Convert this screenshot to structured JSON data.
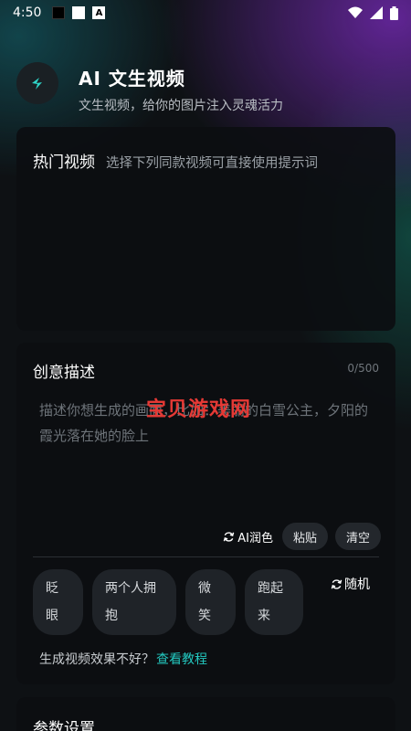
{
  "status_bar": {
    "time": "4:50"
  },
  "header": {
    "title": "AI 文生视频",
    "subtitle": "文生视频，给你的图片注入灵魂活力"
  },
  "hot_videos": {
    "title": "热门视频",
    "hint": "选择下列同款视频可直接使用提示词"
  },
  "creative": {
    "title": "创意描述",
    "counter": "0/500",
    "placeholder": "描述你想生成的画面，比如：美丽的白雪公主，夕阳的霞光落在她的脸上",
    "watermark": "宝贝游戏网",
    "ai_polish_label": "AI润色",
    "paste_label": "粘贴",
    "clear_label": "清空",
    "chips": [
      "眨眼",
      "两个人拥抱",
      "微笑",
      "跑起来"
    ],
    "random_label": "随机",
    "tutorial_text": "生成视频效果不好？",
    "tutorial_link": "查看教程"
  },
  "params": {
    "title": "参数设置"
  },
  "colors": {
    "accent": "#23c8c0",
    "watermark": "#e53935"
  }
}
